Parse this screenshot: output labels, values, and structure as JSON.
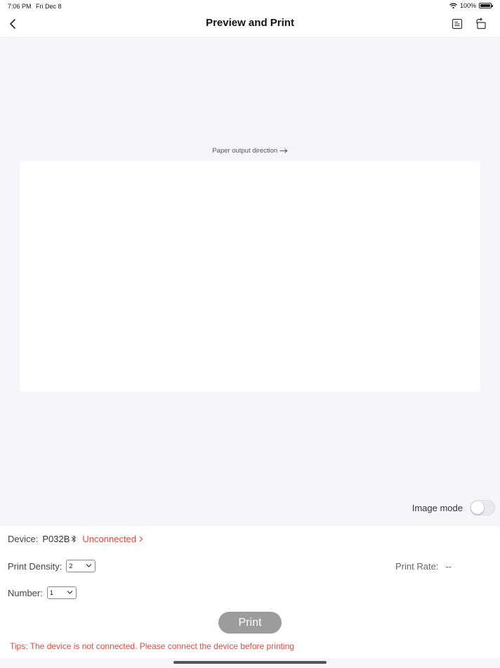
{
  "status_bar": {
    "time": "7:06 PM",
    "date": "Fri Dec 8",
    "battery": "100%",
    "battery_level": 1.0
  },
  "nav": {
    "title": "Preview and Print"
  },
  "preview": {
    "paper_direction": "Paper output direction"
  },
  "image_mode": {
    "label": "Image mode",
    "enabled": false
  },
  "device": {
    "label": "Device:",
    "name": "P032B",
    "status": "Unconnected"
  },
  "density": {
    "label": "Print Density:",
    "value": "2"
  },
  "rate": {
    "label": "Print Rate:",
    "value": "--"
  },
  "number": {
    "label": "Number:",
    "value": "1"
  },
  "print_button": {
    "label": "Print"
  },
  "tips": "Tips: The device is not connected. Please connect the device before printing",
  "colors": {
    "accent_red": "#e5483d",
    "print_button_disabled": "#9c9c9c",
    "preview_background": "#f5f5fa"
  }
}
